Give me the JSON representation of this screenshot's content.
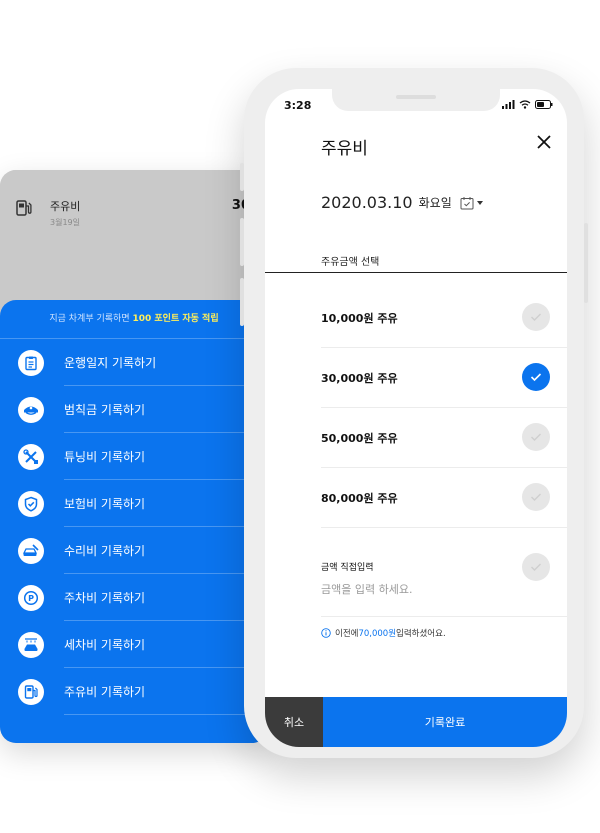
{
  "back_card": {
    "fuel_title": "주유비",
    "fuel_date": "3월19일",
    "fuel_amount": "30,0",
    "banner_prefix": "지금 차계부 기록하면 ",
    "banner_highlight": "100 포인트 자동 적립",
    "menu": [
      {
        "label": "운행일지 기록하기",
        "icon": "clipboard-icon"
      },
      {
        "label": "범칙금 기록하기",
        "icon": "police-cap-icon"
      },
      {
        "label": "튜닝비 기록하기",
        "icon": "tools-icon"
      },
      {
        "label": "보험비 기록하기",
        "icon": "shield-icon"
      },
      {
        "label": "수리비 기록하기",
        "icon": "repair-car-icon"
      },
      {
        "label": "주차비 기록하기",
        "icon": "parking-icon"
      },
      {
        "label": "세차비 기록하기",
        "icon": "car-wash-icon"
      },
      {
        "label": "주유비 기록하기",
        "icon": "fuel-pump-icon"
      }
    ]
  },
  "status_bar": {
    "time": "3:28"
  },
  "modal": {
    "title": "주유비",
    "date": "2020.03.10",
    "weekday": "화요일",
    "section_label": "주유금액 선택",
    "options": [
      {
        "label": "10,000원 주유",
        "selected": false
      },
      {
        "label": "30,000원 주유",
        "selected": true
      },
      {
        "label": "50,000원 주유",
        "selected": false
      },
      {
        "label": "80,000원 주유",
        "selected": false
      }
    ],
    "direct_label": "금액 직접입력",
    "direct_placeholder": "금액을 입력 하세요.",
    "note_prefix": "이전에 ",
    "note_amount": "70,000원",
    "note_suffix": " 입력하셨어요.",
    "cancel_label": "취소",
    "done_label": "기록완료"
  },
  "colors": {
    "accent": "#0b74ee",
    "highlight": "#ffef5a",
    "dark": "#3b3b3b"
  }
}
